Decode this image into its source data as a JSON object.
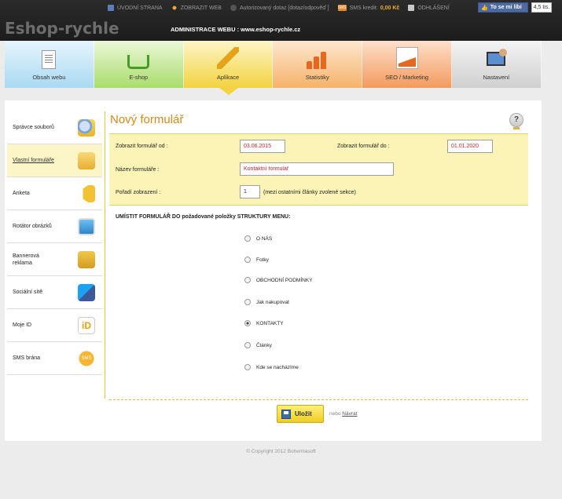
{
  "top_links": {
    "home": "ÚVODNÍ STRANA",
    "view_web": "ZOBRAZIT WEB",
    "authorized_query": "Autorizovaný dotaz [dotaz/odpověď ]",
    "sms_credit_label": "SMS kredit:",
    "sms_credit_value": "0,00 Kč",
    "logout": "ODHLÁŠENÍ",
    "like_button": "To se mi líbí",
    "like_count": "4,5 tis."
  },
  "logo": "Eshop-rychle",
  "admin_title": "ADMINISTRACE WEBU : www.eshop-rychle.cz",
  "nav_tabs": [
    {
      "label": "Obsah webu"
    },
    {
      "label": "E-shop"
    },
    {
      "label": "Aplikace"
    },
    {
      "label": "Statistiky"
    },
    {
      "label": "SEO / Marketing"
    },
    {
      "label": "Nastavení"
    }
  ],
  "sidebar": {
    "items": [
      {
        "label": "Správce souborů"
      },
      {
        "label": "Vlastní formuláře"
      },
      {
        "label": "Anketa"
      },
      {
        "label": "Rotátor obrázků"
      },
      {
        "label": "Bannerová reklama"
      },
      {
        "label": "Sociální sítě"
      },
      {
        "label": "Moje ID"
      },
      {
        "label": "SMS brána"
      }
    ]
  },
  "page_title": "Nový formulář",
  "form": {
    "show_from_label": "Zobrazit formulář od :",
    "show_from_value": "03.06.2015",
    "show_to_label": "Zobrazit formulář do :",
    "show_to_value": "01.01.2020",
    "name_label": "Název formuláře :",
    "name_value": "Kontaktní formulář",
    "order_label": "Pořadí zobrazení :",
    "order_value": "1",
    "order_note": "(mezi ostatními články zvolené sekce)"
  },
  "menu_section": {
    "heading": "UMÍSTIT FORMULÁŘ DO požadované položky STRUKTURY MENU:",
    "options": [
      {
        "label": "O NÁS",
        "checked": false
      },
      {
        "label": "Fotky",
        "checked": false
      },
      {
        "label": "OBCHODNÍ PODMÍNKY",
        "checked": false
      },
      {
        "label": "Jak nakupovat",
        "checked": false
      },
      {
        "label": "KONTAKTY",
        "checked": true
      },
      {
        "label": "Články",
        "checked": false
      },
      {
        "label": "Kde se nacházíme",
        "checked": false
      }
    ]
  },
  "actions": {
    "save": "Uložit",
    "or": "nebo",
    "back": "Návrat"
  },
  "footer": {
    "copyright": "© Copyright 2012 Bohemiasoft"
  },
  "colors": {
    "title_orange": "#d98a1a",
    "form_bg": "#fbf4b6",
    "active_tab": "#f3d33f"
  }
}
